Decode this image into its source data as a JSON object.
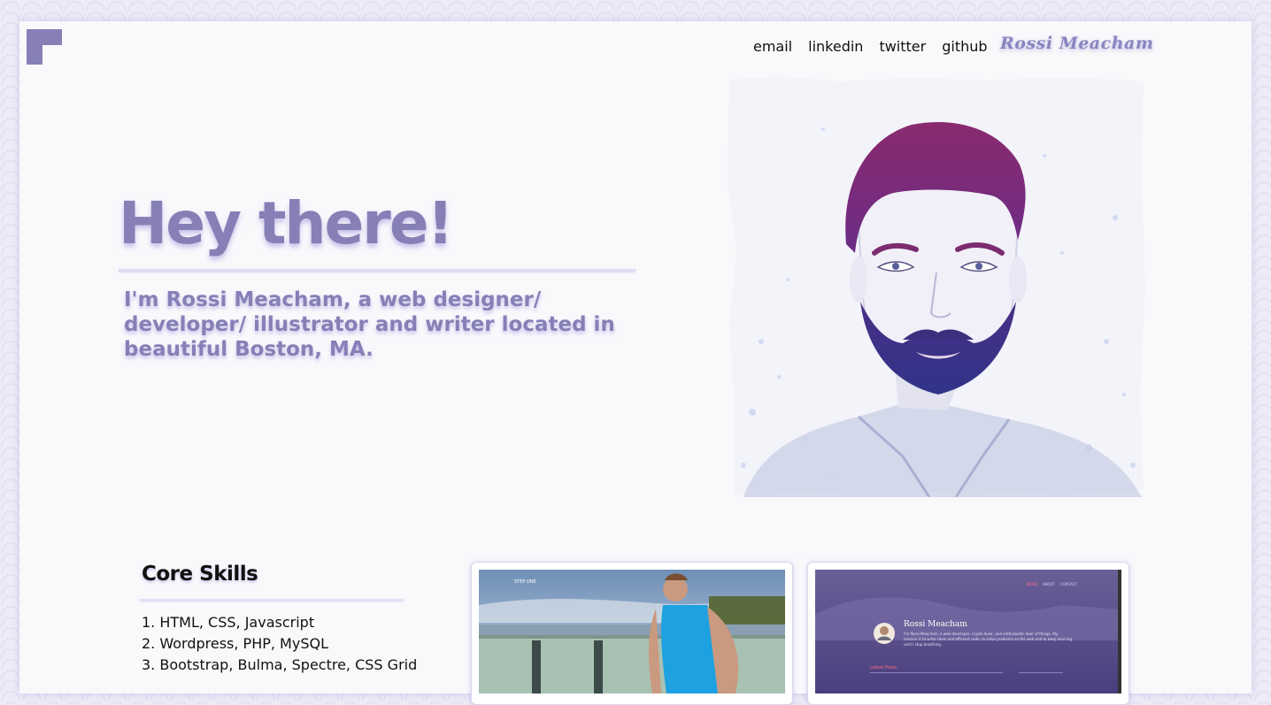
{
  "nav": {
    "links": [
      "email",
      "linkedin",
      "twitter",
      "github"
    ],
    "signature": "Rossi Meacham"
  },
  "hero": {
    "title": "Hey there!",
    "intro": "I'm Rossi Meacham, a web designer/ developer/ illustrator and writer located in beautiful Boston, MA."
  },
  "skills": {
    "heading": "Core Skills",
    "items": [
      "1. HTML, CSS, Javascript",
      "2. Wordpress, PHP, MySQL",
      "3. Bootstrap, Bulma, Spectre, CSS Grid"
    ]
  },
  "portfolio": {
    "card2": {
      "nav": [
        "WORK",
        "ABOUT",
        "CONTACT"
      ],
      "name": "Rossi Meacham",
      "bio": "I'm Rossi Meacham, a web developer, crypto lover, and enthusiastic doer of things. My mission is to write clean and efficient code, to solve problems on the web and to keep learning until I stop breathing.",
      "latest": "Latest Posts"
    }
  },
  "colors": {
    "accent": "#8680b6",
    "page_bg": "#f9f9fc",
    "pattern_bg": "#ecebf6"
  },
  "icons": {
    "logo": "corner-square-logo"
  }
}
